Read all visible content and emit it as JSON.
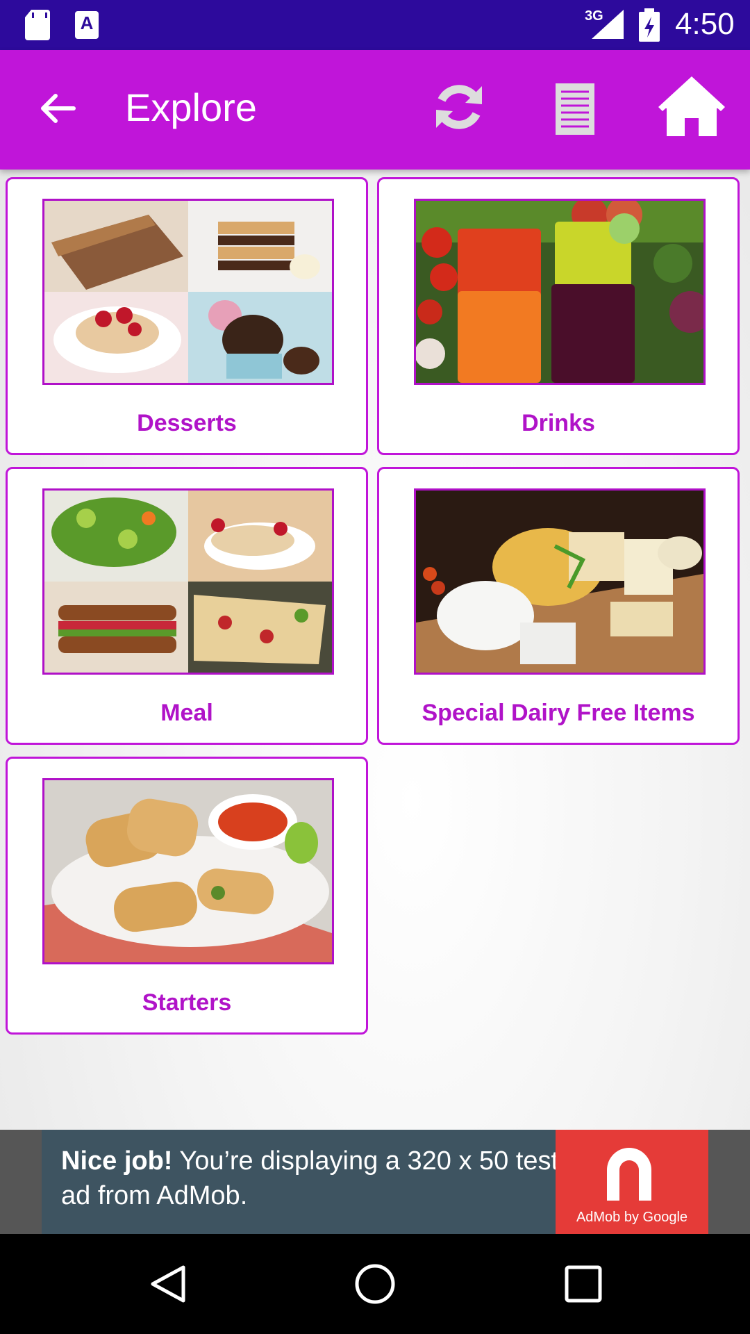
{
  "status_bar": {
    "network": "3G",
    "time": "4:50"
  },
  "toolbar": {
    "title": "Explore"
  },
  "categories": [
    {
      "label": "Desserts"
    },
    {
      "label": "Drinks"
    },
    {
      "label": "Meal"
    },
    {
      "label": "Special Dairy Free Items"
    },
    {
      "label": "Starters"
    }
  ],
  "ad": {
    "headline": "Nice job!",
    "body": " You’re displaying a 320 x 50 test ad from AdMob.",
    "brand": "AdMob by Google"
  },
  "colors": {
    "accent": "#c015d9",
    "status_bar": "#2d0a9c",
    "label": "#b013c8"
  }
}
